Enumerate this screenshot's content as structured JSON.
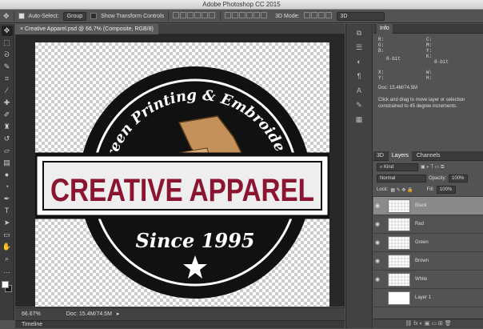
{
  "app_title": "Adobe Photoshop CC 2015",
  "options_bar": {
    "auto_select_label": "Auto-Select:",
    "auto_select_value": "Group",
    "show_transform_label": "Show Transform Controls",
    "mode_3d_label": "3D Mode:",
    "workspace_value": "3D"
  },
  "document": {
    "tab_title": "Creative Apparel.psd @ 66.7% (Composite, RGB/8)",
    "zoom": "66.67%",
    "doc_size": "Doc: 15.4M/74.5M"
  },
  "logo": {
    "arc_text": "Screen Printing & Embroidery",
    "main_text": "CREATIVE APPAREL",
    "since_text": "Since 1995"
  },
  "timeline_label": "Timeline",
  "info_panel": {
    "tab": "Info",
    "rgb_labels": [
      "R:",
      "G:",
      "B:"
    ],
    "cmyk_labels": [
      "C:",
      "M:",
      "Y:",
      "K:"
    ],
    "bit_left": "8-bit",
    "bit_right": "8-bit",
    "xy_labels": [
      "X:",
      "Y:"
    ],
    "wh_labels": [
      "W:",
      "H:"
    ],
    "doc_size": "Doc: 15.4M/74.5M",
    "hint": "Click and drag to move layer or selection constrained to 45 degree increments."
  },
  "layers_panel": {
    "tabs": [
      "3D",
      "Layers",
      "Channels"
    ],
    "active_tab": "Layers",
    "filter_label": "Kind",
    "blend_mode": "Normal",
    "opacity_label": "Opacity:",
    "opacity_value": "100%",
    "lock_label": "Lock:",
    "fill_label": "Fill:",
    "fill_value": "100%",
    "layers": [
      {
        "name": "Black",
        "selected": true
      },
      {
        "name": "Red",
        "selected": false
      },
      {
        "name": "Green",
        "selected": false
      },
      {
        "name": "Brown",
        "selected": false
      },
      {
        "name": "White",
        "selected": false
      },
      {
        "name": "Layer 1",
        "selected": false
      }
    ]
  },
  "colors": {
    "logo_black": "#111111",
    "logo_red": "#8b1430",
    "logo_green": "#3aa531",
    "logo_brown": "#c4915a"
  }
}
